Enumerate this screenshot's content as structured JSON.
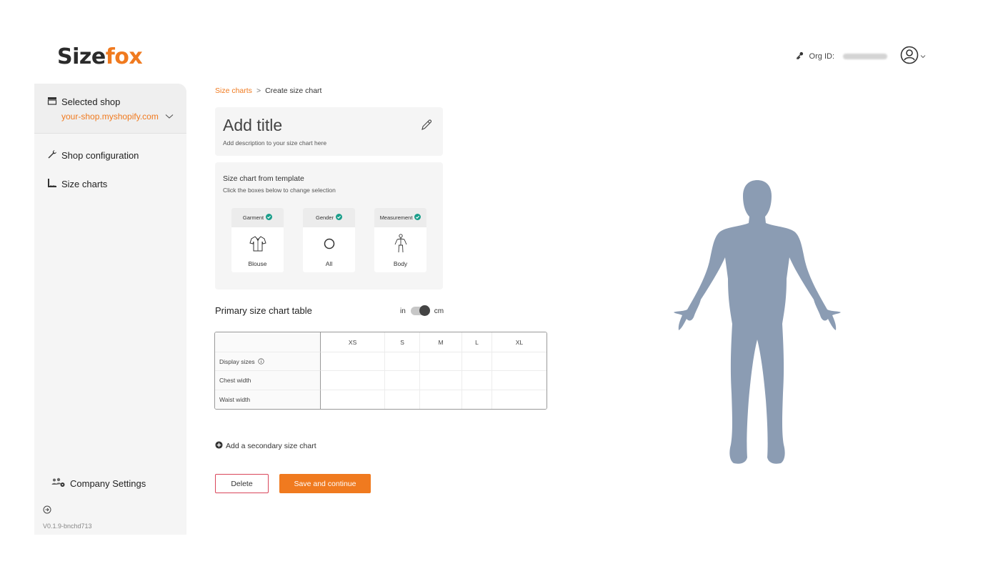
{
  "brand": {
    "part1": "Size",
    "part2": "fox",
    "accent": "#f07a1f"
  },
  "header": {
    "org_label": "Org ID:"
  },
  "sidebar": {
    "shop_title": "Selected shop",
    "shop_url": "your-shop.myshopify.com",
    "items": [
      {
        "label": "Shop configuration",
        "icon": "wrench-icon"
      },
      {
        "label": "Size charts",
        "icon": "ruler-icon"
      }
    ],
    "company_settings": "Company Settings",
    "version": "V0.1.9-bnchd713"
  },
  "breadcrumb": {
    "parent": "Size charts",
    "separator": ">",
    "current": "Create size chart"
  },
  "title_card": {
    "title": "Add title",
    "description": "Add description to your size chart here"
  },
  "template": {
    "title": "Size chart from template",
    "subtitle": "Click the boxes below to change selection",
    "boxes": [
      {
        "header": "Garment",
        "value": "Blouse",
        "icon": "blouse-icon"
      },
      {
        "header": "Gender",
        "value": "All",
        "icon": "circle-icon"
      },
      {
        "header": "Measurement",
        "value": "Body",
        "icon": "body-icon"
      }
    ]
  },
  "primary_table": {
    "title": "Primary size chart table",
    "unit_left": "in",
    "unit_right": "cm",
    "unit_selected": "cm",
    "columns": [
      "XS",
      "S",
      "M",
      "L",
      "XL"
    ],
    "rows": [
      {
        "label": "Display sizes",
        "info_icon": true
      },
      {
        "label": "Chest width"
      },
      {
        "label": "Waist width"
      }
    ]
  },
  "add_secondary": "Add a secondary size chart",
  "actions": {
    "delete": "Delete",
    "save": "Save and continue"
  },
  "colors": {
    "accent": "#f07a1f",
    "check": "#1a9e8a",
    "figure": "#8b9cb3",
    "delete_border": "#d9465b"
  }
}
